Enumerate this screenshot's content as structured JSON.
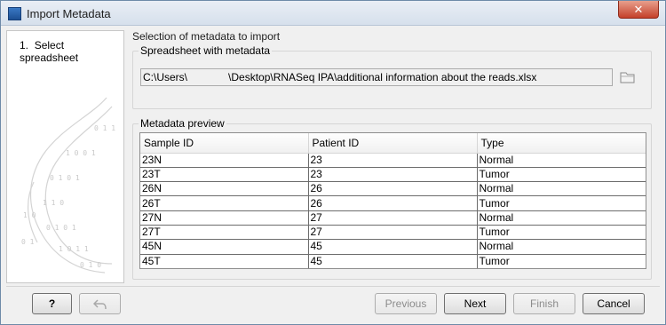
{
  "window": {
    "title": "Import Metadata",
    "icons": {
      "app": "app-icon",
      "close": "close-icon"
    },
    "close_glyph": "✕"
  },
  "steps": [
    {
      "number": "1.",
      "label": "Select spreadsheet"
    }
  ],
  "main": {
    "section_title": "Selection of metadata to import",
    "spreadsheet_group": {
      "legend": "Spreadsheet with metadata",
      "path_prefix": "C:\\Users\\",
      "path_suffix": "\\Desktop\\RNASeq IPA\\additional information about the reads.xlsx",
      "browse_icon": "folder-icon"
    },
    "preview_group": {
      "legend": "Metadata preview",
      "columns": [
        "Sample ID",
        "Patient ID",
        "Type"
      ],
      "rows": [
        [
          "23N",
          "23",
          "Normal"
        ],
        [
          "23T",
          "23",
          "Tumor"
        ],
        [
          "26N",
          "26",
          "Normal"
        ],
        [
          "26T",
          "26",
          "Tumor"
        ],
        [
          "27N",
          "27",
          "Normal"
        ],
        [
          "27T",
          "27",
          "Tumor"
        ],
        [
          "45N",
          "45",
          "Normal"
        ],
        [
          "45T",
          "45",
          "Tumor"
        ]
      ]
    }
  },
  "footer": {
    "help_label": "?",
    "undo_icon": "undo-arrow-icon",
    "previous_label": "Previous",
    "next_label": "Next",
    "finish_label": "Finish",
    "cancel_label": "Cancel"
  },
  "colors": {
    "title_bar": "#d6e0ec",
    "close_button": "#c4402a",
    "dialog_background": "#f0f0f0",
    "decoration": "#c9c9c9"
  }
}
